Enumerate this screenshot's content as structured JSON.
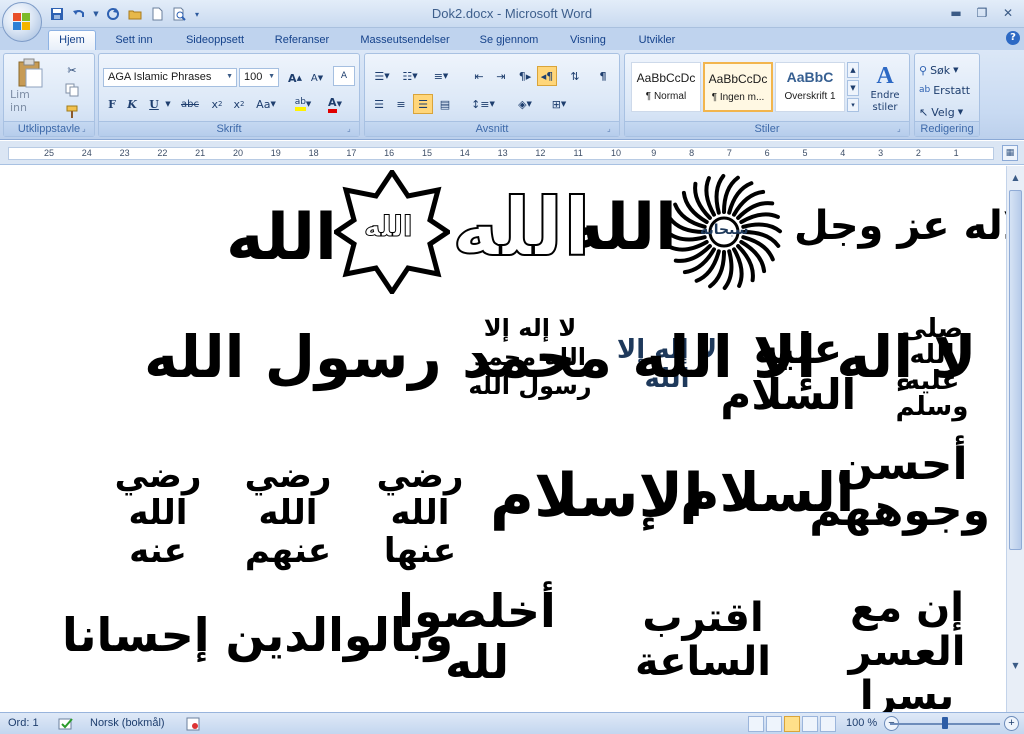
{
  "window": {
    "title": "Dok2.docx - Microsoft Word"
  },
  "quick_access": [
    "save-icon",
    "undo-icon",
    "redo-icon",
    "open-icon",
    "new-icon",
    "print-preview-icon"
  ],
  "tabs": [
    "Hjem",
    "Sett inn",
    "Sideoppsett",
    "Referanser",
    "Masseutsendelser",
    "Se gjennom",
    "Visning",
    "Utvikler"
  ],
  "ribbon": {
    "clipboard": {
      "label": "Utklippstavle",
      "paste_label": "Lim inn"
    },
    "font": {
      "label": "Skrift",
      "font_name": "AGA Islamic Phrases",
      "font_size": "100"
    },
    "paragraph": {
      "label": "Avsnitt"
    },
    "styles": {
      "label": "Stiler",
      "tiles": [
        {
          "sample": "AaBbCcDc",
          "name": "¶ Normal"
        },
        {
          "sample": "AaBbCcDc",
          "name": "¶ Ingen m..."
        },
        {
          "sample": "AaBbC",
          "name": "Overskrift 1"
        }
      ],
      "change_styles": "Endre stiler"
    },
    "editing": {
      "label": "Redigering",
      "find": "Søk",
      "replace": "Erstatt",
      "select": "Velg"
    }
  },
  "ruler": {
    "numbers": [
      "25",
      "24",
      "23",
      "22",
      "21",
      "20",
      "19",
      "18",
      "17",
      "16",
      "15",
      "14",
      "13",
      "12",
      "11",
      "10",
      "9",
      "8",
      "7",
      "6",
      "5",
      "4",
      "3",
      "2",
      "1"
    ]
  },
  "document": {
    "rows": [
      [
        "جل جلاله عز وجل",
        "سبحانه",
        "الله",
        "الله",
        "الله"
      ],
      [
        "صلى الله عليه وسلم",
        "عليه السلام",
        "لا إله إلا الله",
        "لا إله إلا الله محمد رسول الله",
        "لا إله إلا الله محمد رسول الله"
      ],
      [
        "أحسن وجوههم",
        "السلام",
        "الإسلام",
        "رضي الله عنها",
        "رضي الله عنهم",
        "رضي الله عنه"
      ],
      [
        "إن مع العسر يسرا",
        "اقترب الساعة",
        "أخلصوا لله",
        "وبالوالدين إحسانا"
      ]
    ]
  },
  "status": {
    "words": "Ord: 1",
    "language": "Norsk (bokmål)",
    "zoom": "100 %",
    "zoom_fraction": 0.5
  }
}
